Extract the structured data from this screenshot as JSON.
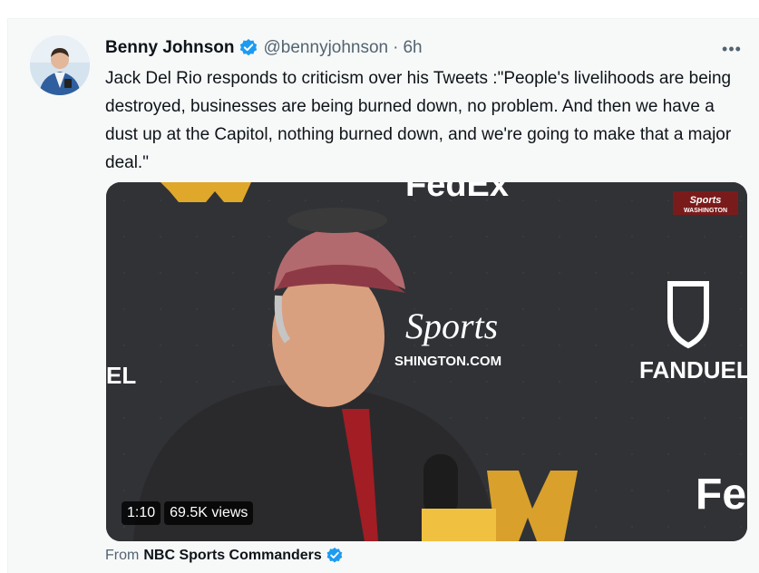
{
  "tweet": {
    "author_name": "Benny Johnson",
    "author_handle": "@bennyjohnson",
    "separator": "·",
    "time": "6h",
    "more_label": "•••",
    "text": "Jack Del Rio responds to criticism over his Tweets :\"People's livelihoods are being destroyed, businesses are being burned down, no problem. And then we have a dust up at the Capitol, nothing burned down, and we're going to make that a major deal.\"",
    "verified_color": "#1d9bf0"
  },
  "video": {
    "duration": "1:10",
    "views": "69.5K views",
    "broadcaster_line1": "Sports",
    "broadcaster_line2": "WASHINGTON",
    "backdrop_texts": {
      "fedex_top": "FedEx",
      "sports": "Sports",
      "washington_com": "SHINGTON.COM",
      "el": "EL",
      "fanduel": "FANDUEL",
      "fedex_bottom": "Fe"
    }
  },
  "source": {
    "from_label": "From",
    "name": "NBC Sports Commanders"
  }
}
